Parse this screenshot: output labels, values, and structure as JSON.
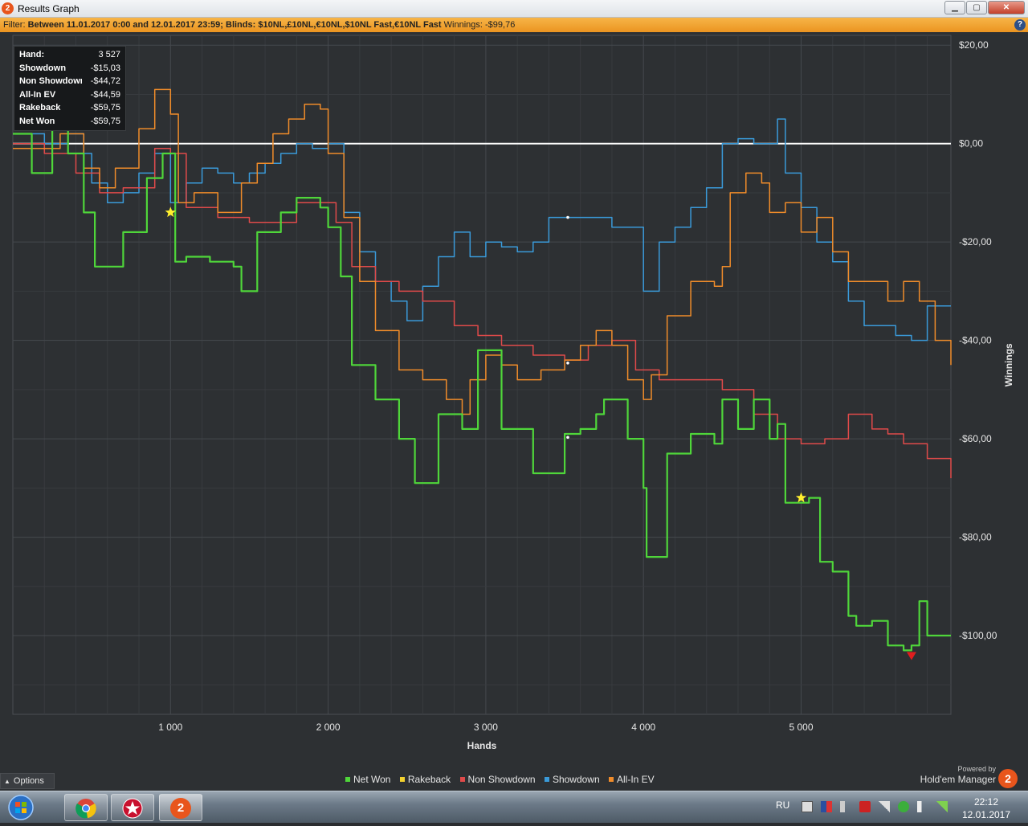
{
  "window": {
    "title": "Results Graph",
    "app_icon": "2",
    "minimize_glyph": "▁",
    "maximize_glyph": "▢",
    "close_glyph": "✕"
  },
  "filter": {
    "prefix": "Filter: ",
    "text": "Between 11.01.2017 0:00 and 12.01.2017 23:59; Blinds: $10NL,£10NL,€10NL,$10NL Fast,€10NL Fast",
    "winnings_label": " Winnings: ",
    "winnings_value": "-$99,76",
    "help_icon": "?"
  },
  "tooltip": {
    "rows": [
      {
        "label": "Hand:",
        "value": "3 527"
      },
      {
        "label": "Showdown",
        "value": "-$15,03"
      },
      {
        "label": "Non Showdown",
        "value": "-$44,72"
      },
      {
        "label": "All-In EV",
        "value": "-$44,59"
      },
      {
        "label": "Rakeback",
        "value": "-$59,75"
      },
      {
        "label": "Net Won",
        "value": "-$59,75"
      }
    ]
  },
  "colors": {
    "net_won": "#4fd63a",
    "rakeback": "#f2d12e",
    "non_showdown": "#e04a4a",
    "showdown": "#3a9ad9",
    "all_in_ev": "#f08c2a",
    "zero_line": "#ffffff"
  },
  "chart_data": {
    "type": "line",
    "xlabel": "Hands",
    "ylabel": "Winnings",
    "xlim": [
      0,
      5950
    ],
    "ylim": [
      -116,
      22
    ],
    "x_ticks": [
      1000,
      2000,
      3000,
      4000,
      5000
    ],
    "x_tick_labels": [
      "1 000",
      "2 000",
      "3 000",
      "4 000",
      "5 000"
    ],
    "y_ticks": [
      20,
      0,
      -20,
      -40,
      -60,
      -80,
      -100
    ],
    "y_tick_labels": [
      "$20,00",
      "$0,00",
      "-$20,00",
      "-$40,00",
      "-$60,00",
      "-$80,00",
      "-$100,00"
    ],
    "grid": true,
    "legend_position": "bottom",
    "series": [
      {
        "name": "Net Won",
        "x": [
          0,
          120,
          250,
          350,
          450,
          520,
          700,
          850,
          950,
          1030,
          1100,
          1250,
          1400,
          1450,
          1550,
          1700,
          1800,
          1950,
          2000,
          2080,
          2150,
          2300,
          2450,
          2550,
          2700,
          2850,
          2950,
          3100,
          3300,
          3500,
          3600,
          3700,
          3750,
          3900,
          4000,
          4020,
          4150,
          4300,
          4450,
          4500,
          4600,
          4700,
          4800,
          4850,
          4900,
          4950,
          5050,
          5120,
          5200,
          5300,
          5350,
          5450,
          5550,
          5650,
          5700,
          5750,
          5800,
          5950
        ],
        "y": [
          2,
          -6,
          3,
          -2,
          -14,
          -25,
          -18,
          -7,
          -2,
          -24,
          -23,
          -24,
          -25,
          -30,
          -18,
          -14,
          -11,
          -13,
          -17,
          -27,
          -45,
          -52,
          -60,
          -69,
          -55,
          -58,
          -42,
          -58,
          -67,
          -59,
          -58,
          -55,
          -52,
          -60,
          -70,
          -84,
          -63,
          -59,
          -61,
          -52,
          -58,
          -52,
          -60,
          -57,
          -73,
          -73,
          -72,
          -85,
          -87,
          -96,
          -98,
          -97,
          -102,
          -103,
          -102,
          -93,
          -100,
          -100
        ]
      },
      {
        "name": "Rakeback",
        "x": [
          0,
          5950
        ],
        "y": [
          0,
          0
        ]
      },
      {
        "name": "Non Showdown",
        "x": [
          0,
          200,
          400,
          550,
          700,
          900,
          1000,
          1100,
          1300,
          1500,
          1650,
          1800,
          1950,
          2050,
          2150,
          2300,
          2450,
          2600,
          2800,
          2950,
          3100,
          3300,
          3500,
          3650,
          3800,
          3950,
          4100,
          4300,
          4500,
          4700,
          4850,
          5000,
          5150,
          5300,
          5450,
          5550,
          5650,
          5800,
          5950
        ],
        "y": [
          0,
          -2,
          -6,
          -10,
          -9,
          -1,
          -2,
          -13,
          -15,
          -16,
          -16,
          -12,
          -12,
          -16,
          -25,
          -28,
          -30,
          -32,
          -37,
          -39,
          -41,
          -43,
          -44,
          -41,
          -40,
          -46,
          -48,
          -48,
          -50,
          -55,
          -60,
          -61,
          -60,
          -55,
          -58,
          -59,
          -61,
          -64,
          -68
        ]
      },
      {
        "name": "Showdown",
        "x": [
          0,
          200,
          350,
          450,
          500,
          600,
          700,
          800,
          900,
          1000,
          1100,
          1200,
          1300,
          1400,
          1500,
          1600,
          1700,
          1800,
          1900,
          2000,
          2100,
          2200,
          2300,
          2400,
          2500,
          2600,
          2700,
          2800,
          2900,
          3000,
          3100,
          3200,
          3300,
          3400,
          3500,
          3600,
          3700,
          3800,
          3900,
          4000,
          4100,
          4200,
          4300,
          4400,
          4500,
          4600,
          4700,
          4800,
          4850,
          4900,
          5000,
          5100,
          5200,
          5300,
          5400,
          5500,
          5600,
          5700,
          5800,
          5950
        ],
        "y": [
          2,
          0,
          2,
          -2,
          -8,
          -12,
          -10,
          -6,
          -2,
          -12,
          -8,
          -5,
          -6,
          -8,
          -6,
          -4,
          -2,
          0,
          -1,
          0,
          -14,
          -22,
          -28,
          -32,
          -36,
          -29,
          -23,
          -18,
          -23,
          -20,
          -21,
          -22,
          -20,
          -15,
          -15,
          -15,
          -15,
          -17,
          -17,
          -30,
          -20,
          -17,
          -13,
          -9,
          0,
          1,
          0,
          0,
          5,
          -6,
          -13,
          -20,
          -24,
          -32,
          -37,
          -37,
          -39,
          -40,
          -33,
          -33
        ]
      },
      {
        "name": "All-In EV",
        "x": [
          0,
          150,
          300,
          450,
          550,
          650,
          800,
          900,
          1000,
          1050,
          1150,
          1300,
          1450,
          1550,
          1650,
          1750,
          1850,
          1950,
          2000,
          2100,
          2200,
          2300,
          2450,
          2600,
          2750,
          2850,
          2900,
          3000,
          3100,
          3200,
          3350,
          3500,
          3600,
          3700,
          3800,
          3900,
          4000,
          4050,
          4150,
          4300,
          4450,
          4500,
          4550,
          4650,
          4750,
          4800,
          4900,
          5000,
          5100,
          5200,
          5300,
          5450,
          5550,
          5650,
          5750,
          5850,
          5950
        ],
        "y": [
          -1,
          -1,
          2,
          -5,
          -9,
          -5,
          3,
          11,
          6,
          -12,
          -10,
          -14,
          -8,
          -4,
          2,
          5,
          8,
          7,
          -2,
          -15,
          -28,
          -38,
          -46,
          -48,
          -52,
          -55,
          -48,
          -43,
          -45,
          -48,
          -46,
          -44,
          -41,
          -38,
          -41,
          -48,
          -52,
          -47,
          -35,
          -28,
          -29,
          -25,
          -10,
          -6,
          -8,
          -14,
          -12,
          -18,
          -15,
          -22,
          -28,
          -28,
          -32,
          -28,
          -32,
          -40,
          -45
        ]
      }
    ]
  },
  "options_label": "Options",
  "options_arrow": "▲",
  "legend": [
    {
      "label": "Net Won",
      "color": "#4fd63a"
    },
    {
      "label": "Rakeback",
      "color": "#f2d12e"
    },
    {
      "label": "Non Showdown",
      "color": "#e04a4a"
    },
    {
      "label": "Showdown",
      "color": "#3a9ad9"
    },
    {
      "label": "All-In EV",
      "color": "#f08c2a"
    }
  ],
  "branding": {
    "powered_by": "Powered by",
    "name": "Hold'em Manager",
    "logo": "2"
  },
  "taskbar": {
    "language": "RU",
    "time": "22:12",
    "date": "12.01.2017",
    "hm_icon": "2"
  }
}
